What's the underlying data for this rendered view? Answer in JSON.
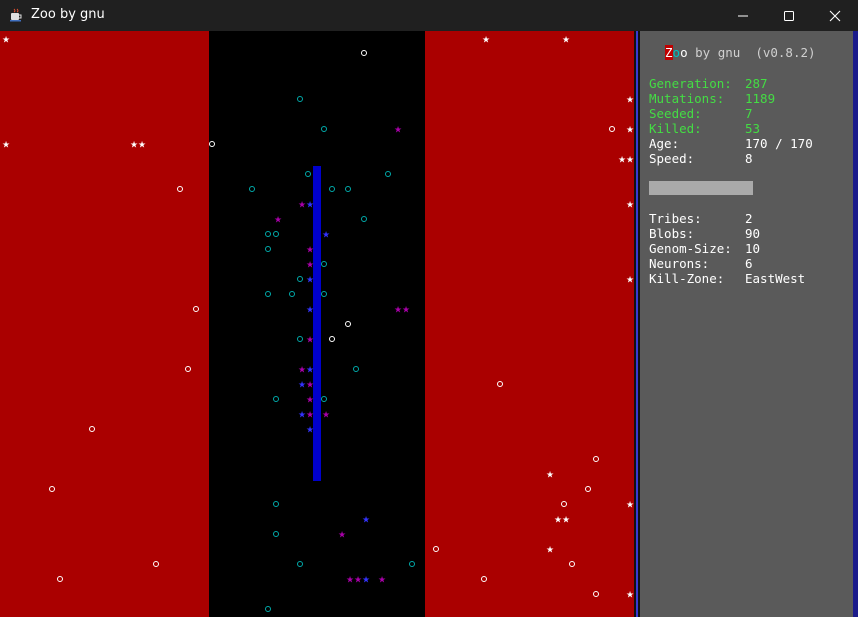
{
  "window": {
    "title": "Zoo by gnu",
    "app_icon": "java-cup-icon",
    "controls": [
      "minimize-icon",
      "maximize-icon",
      "close-icon"
    ]
  },
  "colors": {
    "kill_zone": "#aa0000",
    "arena": "#000000",
    "barrier": "#0000cc",
    "tribe_magenta": "#aa00aa",
    "tribe_blue": "#3333ff",
    "food_cyan": "#00aaaa",
    "food_white": "#ffffff",
    "panel_bg": "#5a5a5a",
    "stat_green": "#44dd44"
  },
  "panel": {
    "app_name_z": "Z",
    "app_name_o1": "o",
    "app_name_o2": "o",
    "app_name_rest": " by gnu  (v0.8.2)",
    "stats": [
      {
        "label": "Generation:",
        "value": "287",
        "color": "green"
      },
      {
        "label": "Mutations:",
        "value": "1189",
        "color": "green"
      },
      {
        "label": "Seeded:",
        "value": "7",
        "color": "green"
      },
      {
        "label": "Killed:",
        "value": "53",
        "color": "green"
      },
      {
        "label": "Age:",
        "value": "170 / 170",
        "color": "white"
      },
      {
        "label": "Speed:",
        "value": "8",
        "color": "white"
      }
    ],
    "age_progress": 1.0,
    "details": [
      {
        "label": "Tribes:",
        "value": "2"
      },
      {
        "label": "Blobs:",
        "value": "90"
      },
      {
        "label": "Genom-Size:",
        "value": "10"
      },
      {
        "label": "Neurons:",
        "value": "6"
      },
      {
        "label": "Kill-Zone:",
        "value": "EastWest"
      }
    ]
  }
}
